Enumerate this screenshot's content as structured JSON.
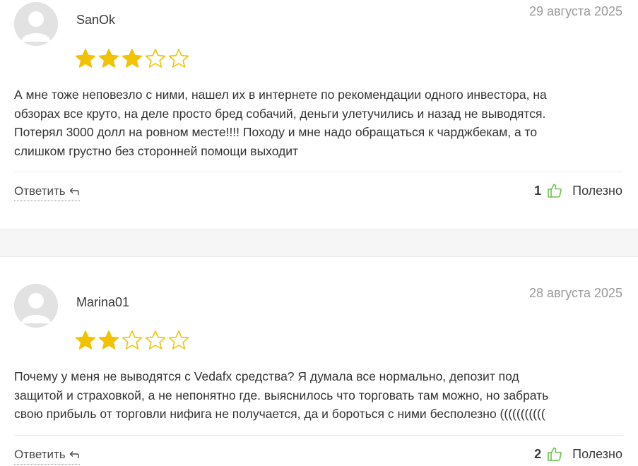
{
  "reviews": [
    {
      "author": "SanOk",
      "date": "29 августа 2025",
      "rating": 3,
      "max_rating": 5,
      "text_lines": [
        "А мне тоже неповезло с ними, нашел их в интернете по рекомендации одного инвестора, на",
        "обзорах все круто, на деле просто бред собачий, деньги улетучились и назад не выводятся.",
        "Потерял 3000 долл на ровном месте!!!! Походу и мне надо обращаться к чарджбекам, а то",
        "слишком грустно без сторонней помощи выходит"
      ],
      "reply_label": "Ответить",
      "helpful_count": "1",
      "helpful_label": "Полезно"
    },
    {
      "author": "Marina01",
      "date": "28 августа 2025",
      "rating": 2,
      "max_rating": 5,
      "text_lines": [
        "Почему у меня не выводятся с Vedafx средства? Я думала все нормально, депозит под",
        "защитой и страховкой, а не непонятно где. выяснилось что торговать там можно, но забрать",
        "свою прибыль от торговли нифига не получается, да и бороться с ними бесполезно (((((((((((",
        ""
      ],
      "reply_label": "Ответить",
      "helpful_count": "2",
      "helpful_label": "Полезно"
    }
  ],
  "icons": {
    "star_filled": "star-filled-icon",
    "star_empty": "star-outline-icon",
    "reply": "reply-arrow-icon",
    "thumb": "thumbs-up-icon",
    "avatar": "default-user-avatar"
  },
  "colors": {
    "star": "#f2c200",
    "thumb": "#6cc24a",
    "date": "#9a9a9a"
  }
}
